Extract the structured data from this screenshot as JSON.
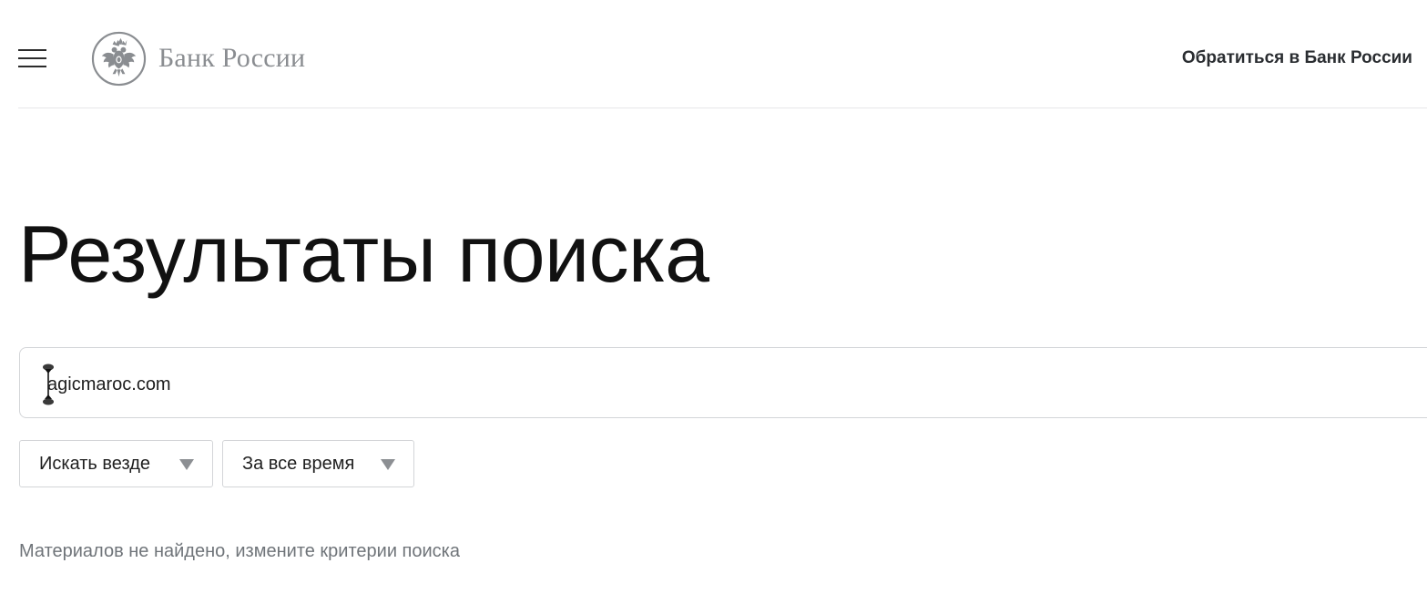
{
  "header": {
    "logo_text": "Банк России",
    "contact_link": "Обратиться в Банк России",
    "icons": {
      "menu": "hamburger-menu-icon",
      "emblem": "double-headed-eagle-emblem"
    }
  },
  "main": {
    "title": "Результаты поиска",
    "search": {
      "value": "agicmaroc.com",
      "placeholder": ""
    },
    "filters": [
      {
        "label": "Искать везде",
        "icon": "dropdown-arrow-icon"
      },
      {
        "label": "За все время",
        "icon": "dropdown-arrow-icon"
      }
    ],
    "empty_message": "Материалов не найдено, измените критерии поиска"
  },
  "colors": {
    "logo_gray": "#8a8d91",
    "border": "#d3d5d8",
    "muted_text": "#6f7479",
    "title": "#111111"
  }
}
